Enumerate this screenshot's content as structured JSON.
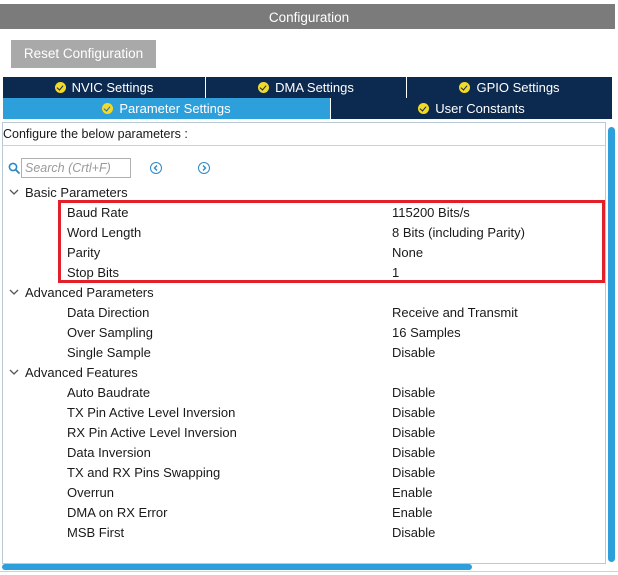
{
  "window": {
    "title": "Configuration"
  },
  "toolbar": {
    "reset_label": "Reset Configuration"
  },
  "tabs": {
    "row1": [
      {
        "label": "NVIC Settings"
      },
      {
        "label": "DMA Settings"
      },
      {
        "label": "GPIO Settings"
      }
    ],
    "row2": [
      {
        "label": "Parameter Settings",
        "active": true
      },
      {
        "label": "User Constants"
      }
    ]
  },
  "panel": {
    "description": "Configure the below parameters :",
    "search_placeholder": "Search (Crtl+F)"
  },
  "groups": [
    {
      "label": "Basic Parameters",
      "params": [
        {
          "name": "Baud Rate",
          "value": "115200 Bits/s"
        },
        {
          "name": "Word Length",
          "value": "8 Bits (including Parity)"
        },
        {
          "name": "Parity",
          "value": "None"
        },
        {
          "name": "Stop Bits",
          "value": "1"
        }
      ]
    },
    {
      "label": "Advanced Parameters",
      "params": [
        {
          "name": "Data Direction",
          "value": "Receive and Transmit"
        },
        {
          "name": "Over Sampling",
          "value": "16 Samples"
        },
        {
          "name": "Single Sample",
          "value": "Disable"
        }
      ]
    },
    {
      "label": "Advanced Features",
      "params": [
        {
          "name": "Auto Baudrate",
          "value": "Disable"
        },
        {
          "name": "TX Pin Active Level Inversion",
          "value": "Disable"
        },
        {
          "name": "RX Pin Active Level Inversion",
          "value": "Disable"
        },
        {
          "name": "Data Inversion",
          "value": "Disable"
        },
        {
          "name": "TX and RX Pins Swapping",
          "value": "Disable"
        },
        {
          "name": "Overrun",
          "value": "Enable"
        },
        {
          "name": "DMA on RX Error",
          "value": "Enable"
        },
        {
          "name": "MSB First",
          "value": "Disable"
        }
      ]
    }
  ],
  "colors": {
    "title_bar": "#7b7b7b",
    "tab_dark": "#0c2a4f",
    "tab_active": "#2d9fdb",
    "check_icon": "#f3da2a",
    "highlight_box": "#e3202a",
    "scrollbar": "#2d9fdb"
  }
}
